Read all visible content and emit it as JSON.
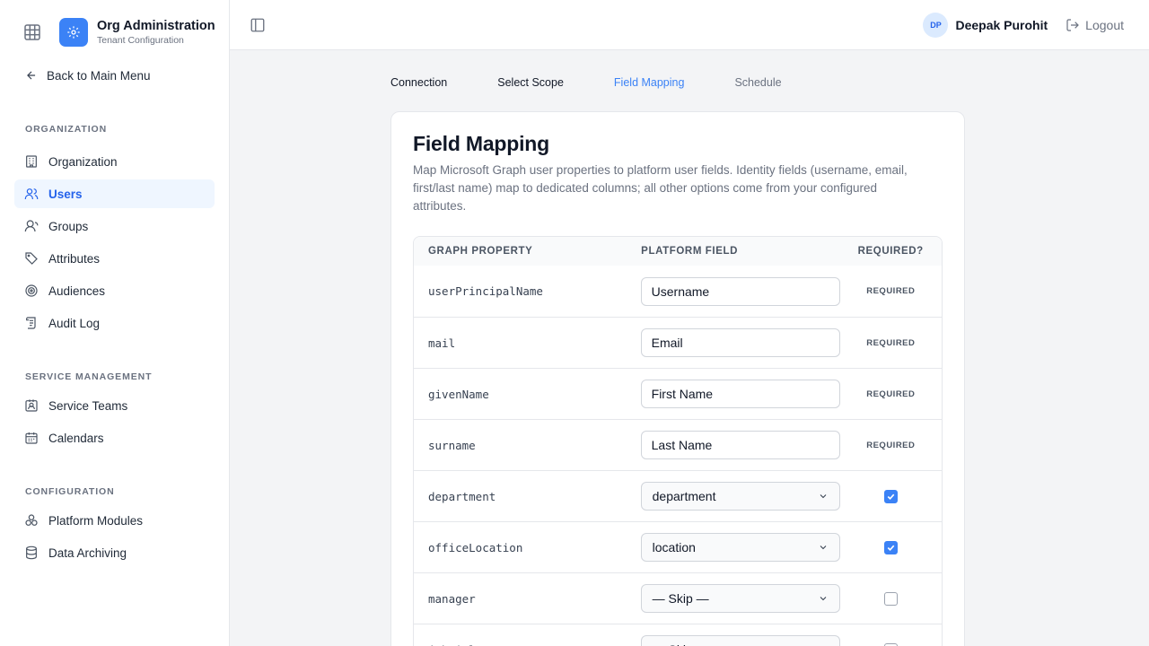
{
  "brand": {
    "title": "Org Administration",
    "subtitle": "Tenant Configuration"
  },
  "sidebar": {
    "back_label": "Back to Main Menu",
    "sections": [
      {
        "label": "ORGANIZATION",
        "items": [
          {
            "label": "Organization",
            "icon": "building-icon"
          },
          {
            "label": "Users",
            "icon": "users-icon",
            "active": true
          },
          {
            "label": "Groups",
            "icon": "group-icon"
          },
          {
            "label": "Attributes",
            "icon": "tag-icon"
          },
          {
            "label": "Audiences",
            "icon": "target-icon"
          },
          {
            "label": "Audit Log",
            "icon": "scroll-icon"
          }
        ]
      },
      {
        "label": "SERVICE MANAGEMENT",
        "items": [
          {
            "label": "Service Teams",
            "icon": "badge-icon"
          },
          {
            "label": "Calendars",
            "icon": "calendar-icon"
          }
        ]
      },
      {
        "label": "CONFIGURATION",
        "items": [
          {
            "label": "Platform Modules",
            "icon": "modules-icon"
          },
          {
            "label": "Data Archiving",
            "icon": "database-icon"
          }
        ]
      }
    ]
  },
  "topbar": {
    "avatar_initials": "DP",
    "user_name": "Deepak Purohit",
    "logout_label": "Logout"
  },
  "steps": [
    {
      "label": "Connection",
      "state": "done"
    },
    {
      "label": "Select Scope",
      "state": "done"
    },
    {
      "label": "Field Mapping",
      "state": "active"
    },
    {
      "label": "Schedule",
      "state": "future"
    }
  ],
  "card": {
    "title": "Field Mapping",
    "description": "Map Microsoft Graph user properties to platform user fields. Identity fields (username, email, first/last name) map to dedicated columns; all other options come from your configured attributes."
  },
  "table": {
    "headers": [
      "GRAPH PROPERTY",
      "PLATFORM FIELD",
      "REQUIRED?"
    ],
    "required_label": "REQUIRED",
    "rows": [
      {
        "property": "userPrincipalName",
        "field": "Username",
        "type": "input",
        "required": "badge"
      },
      {
        "property": "mail",
        "field": "Email",
        "type": "input",
        "required": "badge"
      },
      {
        "property": "givenName",
        "field": "First Name",
        "type": "input",
        "required": "badge"
      },
      {
        "property": "surname",
        "field": "Last Name",
        "type": "input",
        "required": "badge"
      },
      {
        "property": "department",
        "field": "department",
        "type": "select",
        "required": "checked"
      },
      {
        "property": "officeLocation",
        "field": "location",
        "type": "select",
        "required": "checked"
      },
      {
        "property": "manager",
        "field": "— Skip —",
        "type": "select",
        "required": "unchecked"
      },
      {
        "property": "jobTitle",
        "field": "— Skip —",
        "type": "select",
        "required": "unchecked"
      }
    ]
  },
  "colors": {
    "accent": "#3b82f6",
    "active_bg": "#eff6ff"
  }
}
